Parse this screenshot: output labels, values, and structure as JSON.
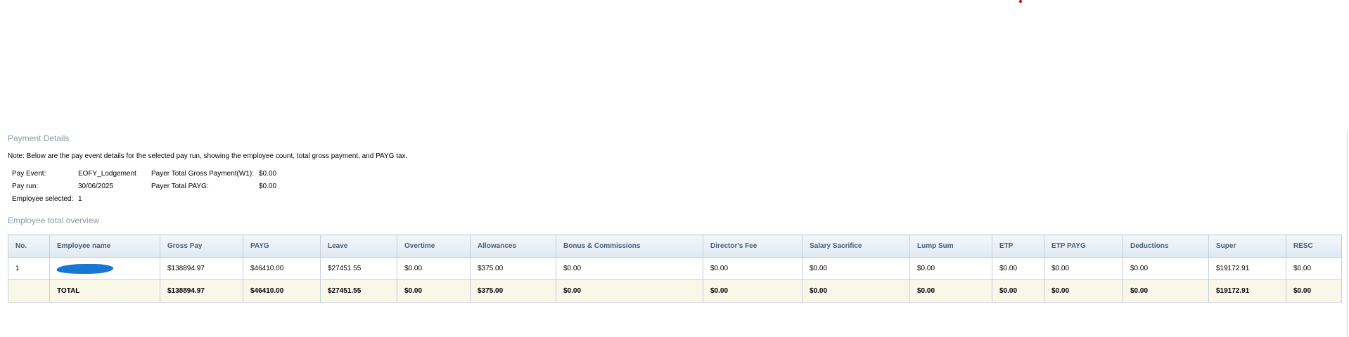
{
  "payment_details": {
    "title": "Payment Details",
    "note": "Note: Below are the pay event details for the selected pay run, showing the employee count, total gross payment, and PAYG tax.",
    "pay_event_label": "Pay Event:",
    "pay_event_value": "EOFY_Lodgement",
    "pay_run_label": "Pay run:",
    "pay_run_value": "30/06/2025",
    "employee_selected_label": "Employee selected:",
    "employee_selected_value": "1",
    "total_gross_label": "Payer Total Gross Payment(W1):",
    "total_gross_value": "$0.00",
    "total_payg_label": "Payer Total PAYG:",
    "total_payg_value": "$0.00"
  },
  "overview": {
    "title": "Employee total overview",
    "columns": [
      "No.",
      "Employee name",
      "Gross Pay",
      "PAYG",
      "Leave",
      "Overtime",
      "Allowances",
      "Bonus & Commissions",
      "Director's Fee",
      "Salary Sacrifice",
      "Lump Sum",
      "ETP",
      "ETP PAYG",
      "Deductions",
      "Super",
      "RESC"
    ],
    "rows": [
      [
        "1",
        "",
        "$138894.97",
        "$46410.00",
        "$27451.55",
        "$0.00",
        "$375.00",
        "$0.00",
        "$0.00",
        "$0.00",
        "$0.00",
        "$0.00",
        "$0.00",
        "$0.00",
        "$19172.91",
        "$0.00"
      ]
    ],
    "total": [
      "",
      "TOTAL",
      "$138894.97",
      "$46410.00",
      "$27451.55",
      "$0.00",
      "$375.00",
      "$0.00",
      "$0.00",
      "$0.00",
      "$0.00",
      "$0.00",
      "$0.00",
      "$0.00",
      "$19172.91",
      "$0.00"
    ]
  },
  "colors": {
    "header_text": "#4a5e72",
    "section_title": "#8a9aa8",
    "total_row_bg": "#f8f7e8",
    "redaction": "#1877d4"
  }
}
